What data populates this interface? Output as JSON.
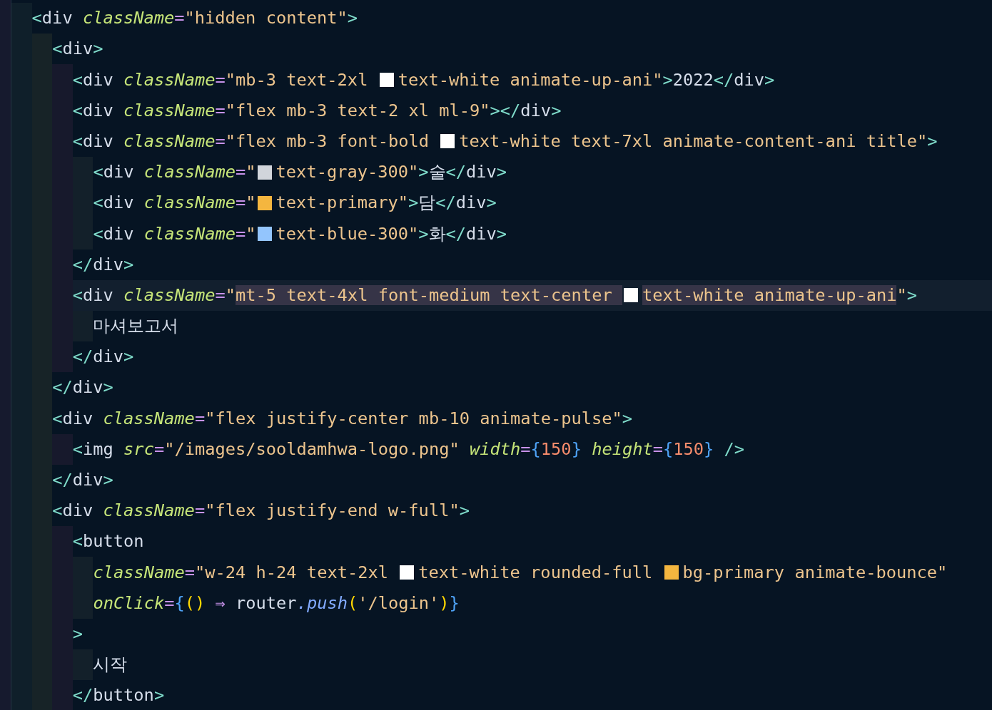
{
  "lines": [
    {
      "current": false,
      "tokens": [
        {
          "kind": "bracket",
          "text": "<"
        },
        {
          "kind": "tag",
          "text": "div"
        },
        {
          "kind": "attr",
          "text": " className"
        },
        {
          "kind": "eq",
          "text": "="
        },
        {
          "kind": "string",
          "text": "\"hidden content\""
        },
        {
          "kind": "bracket",
          "text": ">"
        }
      ],
      "children": [
        {
          "current": false,
          "tokens": [
            {
              "kind": "bracket",
              "text": "<"
            },
            {
              "kind": "tag",
              "text": "div"
            },
            {
              "kind": "bracket",
              "text": ">"
            }
          ],
          "children": [
            {
              "current": false,
              "tokens": [
                {
                  "kind": "bracket",
                  "text": "<"
                },
                {
                  "kind": "tag",
                  "text": "div"
                },
                {
                  "kind": "attr",
                  "text": " className"
                },
                {
                  "kind": "eq",
                  "text": "="
                },
                {
                  "kind": "string",
                  "text": "\"mb-3 text-2xl "
                },
                {
                  "kind": "swatch",
                  "color": "#ffffff"
                },
                {
                  "kind": "string",
                  "text": "text-white animate-up-ani\""
                },
                {
                  "kind": "bracket",
                  "text": ">"
                },
                {
                  "kind": "text",
                  "text": "2022"
                },
                {
                  "kind": "bracket",
                  "text": "</"
                },
                {
                  "kind": "tag",
                  "text": "div"
                },
                {
                  "kind": "bracket",
                  "text": ">"
                }
              ]
            },
            {
              "current": false,
              "tokens": [
                {
                  "kind": "bracket",
                  "text": "<"
                },
                {
                  "kind": "tag",
                  "text": "div"
                },
                {
                  "kind": "attr",
                  "text": " className"
                },
                {
                  "kind": "eq",
                  "text": "="
                },
                {
                  "kind": "string",
                  "text": "\"flex mb-3 text-2 xl ml-9\""
                },
                {
                  "kind": "bracket",
                  "text": "></"
                },
                {
                  "kind": "tag",
                  "text": "div"
                },
                {
                  "kind": "bracket",
                  "text": ">"
                }
              ]
            },
            {
              "current": false,
              "tokens": [
                {
                  "kind": "bracket",
                  "text": "<"
                },
                {
                  "kind": "tag",
                  "text": "div"
                },
                {
                  "kind": "attr",
                  "text": " className"
                },
                {
                  "kind": "eq",
                  "text": "="
                },
                {
                  "kind": "string",
                  "text": "\"flex mb-3 font-bold "
                },
                {
                  "kind": "swatch",
                  "color": "#ffffff"
                },
                {
                  "kind": "string",
                  "text": "text-white text-7xl animate-content-ani title\""
                },
                {
                  "kind": "bracket",
                  "text": ">"
                }
              ],
              "children": [
                {
                  "current": false,
                  "tokens": [
                    {
                      "kind": "bracket",
                      "text": "<"
                    },
                    {
                      "kind": "tag",
                      "text": "div"
                    },
                    {
                      "kind": "attr",
                      "text": " className"
                    },
                    {
                      "kind": "eq",
                      "text": "="
                    },
                    {
                      "kind": "string",
                      "text": "\""
                    },
                    {
                      "kind": "swatch",
                      "color": "#d1d5db"
                    },
                    {
                      "kind": "string",
                      "text": "text-gray-300\""
                    },
                    {
                      "kind": "bracket",
                      "text": ">"
                    },
                    {
                      "kind": "text",
                      "text": "술"
                    },
                    {
                      "kind": "bracket",
                      "text": "</"
                    },
                    {
                      "kind": "tag",
                      "text": "div"
                    },
                    {
                      "kind": "bracket",
                      "text": ">"
                    }
                  ]
                },
                {
                  "current": false,
                  "tokens": [
                    {
                      "kind": "bracket",
                      "text": "<"
                    },
                    {
                      "kind": "tag",
                      "text": "div"
                    },
                    {
                      "kind": "attr",
                      "text": " className"
                    },
                    {
                      "kind": "eq",
                      "text": "="
                    },
                    {
                      "kind": "string",
                      "text": "\""
                    },
                    {
                      "kind": "swatch",
                      "color": "#f4b63f"
                    },
                    {
                      "kind": "string",
                      "text": "text-primary\""
                    },
                    {
                      "kind": "bracket",
                      "text": ">"
                    },
                    {
                      "kind": "text",
                      "text": "담"
                    },
                    {
                      "kind": "bracket",
                      "text": "</"
                    },
                    {
                      "kind": "tag",
                      "text": "div"
                    },
                    {
                      "kind": "bracket",
                      "text": ">"
                    }
                  ]
                },
                {
                  "current": false,
                  "tokens": [
                    {
                      "kind": "bracket",
                      "text": "<"
                    },
                    {
                      "kind": "tag",
                      "text": "div"
                    },
                    {
                      "kind": "attr",
                      "text": " className"
                    },
                    {
                      "kind": "eq",
                      "text": "="
                    },
                    {
                      "kind": "string",
                      "text": "\""
                    },
                    {
                      "kind": "swatch",
                      "color": "#93c5fd"
                    },
                    {
                      "kind": "string",
                      "text": "text-blue-300\""
                    },
                    {
                      "kind": "bracket",
                      "text": ">"
                    },
                    {
                      "kind": "text",
                      "text": "화"
                    },
                    {
                      "kind": "bracket",
                      "text": "</"
                    },
                    {
                      "kind": "tag",
                      "text": "div"
                    },
                    {
                      "kind": "bracket",
                      "text": ">"
                    }
                  ]
                }
              ]
            },
            {
              "current": false,
              "tokens": [
                {
                  "kind": "bracket",
                  "text": "</"
                },
                {
                  "kind": "tag",
                  "text": "div"
                },
                {
                  "kind": "bracket",
                  "text": ">"
                }
              ]
            },
            {
              "current": true,
              "tokens": [
                {
                  "kind": "bracket",
                  "text": "<"
                },
                {
                  "kind": "tag",
                  "text": "div"
                },
                {
                  "kind": "attr",
                  "text": " className"
                },
                {
                  "kind": "eq",
                  "text": "="
                },
                {
                  "kind": "string",
                  "text": "\""
                },
                {
                  "kind": "selection",
                  "text": "mt-5 text-4xl font-medium text-center "
                },
                {
                  "kind": "swatch",
                  "color": "#ffffff"
                },
                {
                  "kind": "selection",
                  "text": "text-white animate-up-ani"
                },
                {
                  "kind": "string",
                  "text": "\""
                },
                {
                  "kind": "bracket",
                  "text": ">"
                }
              ],
              "children": [
                {
                  "current": false,
                  "tokens": [
                    {
                      "kind": "text",
                      "text": "마셔보고서"
                    }
                  ]
                }
              ]
            },
            {
              "current": false,
              "tokens": [
                {
                  "kind": "bracket",
                  "text": "</"
                },
                {
                  "kind": "tag",
                  "text": "div"
                },
                {
                  "kind": "bracket",
                  "text": ">"
                }
              ]
            }
          ]
        },
        {
          "current": false,
          "tokens": [
            {
              "kind": "bracket",
              "text": "</"
            },
            {
              "kind": "tag",
              "text": "div"
            },
            {
              "kind": "bracket",
              "text": ">"
            }
          ]
        },
        {
          "current": false,
          "tokens": [
            {
              "kind": "bracket",
              "text": "<"
            },
            {
              "kind": "tag",
              "text": "div"
            },
            {
              "kind": "attr",
              "text": " className"
            },
            {
              "kind": "eq",
              "text": "="
            },
            {
              "kind": "string",
              "text": "\"flex justify-center mb-10 animate-pulse\""
            },
            {
              "kind": "bracket",
              "text": ">"
            }
          ],
          "children": [
            {
              "current": false,
              "tokens": [
                {
                  "kind": "bracket",
                  "text": "<"
                },
                {
                  "kind": "tag",
                  "text": "img"
                },
                {
                  "kind": "attr",
                  "text": " src"
                },
                {
                  "kind": "eq",
                  "text": "="
                },
                {
                  "kind": "string",
                  "text": "\"/images/sooldamhwa-logo.png\""
                },
                {
                  "kind": "attr",
                  "text": " width"
                },
                {
                  "kind": "eq",
                  "text": "="
                },
                {
                  "kind": "brace",
                  "text": "{"
                },
                {
                  "kind": "number",
                  "text": "150"
                },
                {
                  "kind": "brace",
                  "text": "}"
                },
                {
                  "kind": "attr",
                  "text": " height"
                },
                {
                  "kind": "eq",
                  "text": "="
                },
                {
                  "kind": "brace",
                  "text": "{"
                },
                {
                  "kind": "number",
                  "text": "150"
                },
                {
                  "kind": "brace",
                  "text": "}"
                },
                {
                  "kind": "bracket",
                  "text": " />"
                }
              ]
            }
          ]
        },
        {
          "current": false,
          "tokens": [
            {
              "kind": "bracket",
              "text": "</"
            },
            {
              "kind": "tag",
              "text": "div"
            },
            {
              "kind": "bracket",
              "text": ">"
            }
          ]
        },
        {
          "current": false,
          "tokens": [
            {
              "kind": "bracket",
              "text": "<"
            },
            {
              "kind": "tag",
              "text": "div"
            },
            {
              "kind": "attr",
              "text": " className"
            },
            {
              "kind": "eq",
              "text": "="
            },
            {
              "kind": "string",
              "text": "\"flex justify-end w-full\""
            },
            {
              "kind": "bracket",
              "text": ">"
            }
          ],
          "children": [
            {
              "current": false,
              "tokens": [
                {
                  "kind": "bracket",
                  "text": "<"
                },
                {
                  "kind": "tag",
                  "text": "button"
                }
              ],
              "children": [
                {
                  "current": false,
                  "tokens": [
                    {
                      "kind": "attr",
                      "text": "className"
                    },
                    {
                      "kind": "eq",
                      "text": "="
                    },
                    {
                      "kind": "string",
                      "text": "\"w-24 h-24 text-2xl "
                    },
                    {
                      "kind": "swatch",
                      "color": "#ffffff"
                    },
                    {
                      "kind": "string",
                      "text": "text-white rounded-full "
                    },
                    {
                      "kind": "swatch",
                      "color": "#f4b63f"
                    },
                    {
                      "kind": "string",
                      "text": "bg-primary animate-bounce\""
                    }
                  ]
                },
                {
                  "current": false,
                  "tokens": [
                    {
                      "kind": "attr",
                      "text": "onClick"
                    },
                    {
                      "kind": "eq",
                      "text": "="
                    },
                    {
                      "kind": "brace",
                      "text": "{"
                    },
                    {
                      "kind": "paren",
                      "text": "()"
                    },
                    {
                      "kind": "arrow",
                      "text": " ⇒ "
                    },
                    {
                      "kind": "ident",
                      "text": "router"
                    },
                    {
                      "kind": "method",
                      "text": ".push"
                    },
                    {
                      "kind": "paren",
                      "text": "("
                    },
                    {
                      "kind": "string",
                      "text": "'/login'"
                    },
                    {
                      "kind": "paren",
                      "text": ")"
                    },
                    {
                      "kind": "brace",
                      "text": "}"
                    }
                  ]
                }
              ]
            },
            {
              "current": false,
              "tokens": [
                {
                  "kind": "bracket",
                  "text": ">"
                }
              ],
              "children": [
                {
                  "current": false,
                  "tokens": [
                    {
                      "kind": "text",
                      "text": "시작"
                    }
                  ]
                }
              ]
            },
            {
              "current": false,
              "tokens": [
                {
                  "kind": "bracket",
                  "text": "</"
                },
                {
                  "kind": "tag",
                  "text": "button"
                },
                {
                  "kind": "bracket",
                  "text": ">"
                }
              ]
            }
          ]
        }
      ]
    }
  ]
}
